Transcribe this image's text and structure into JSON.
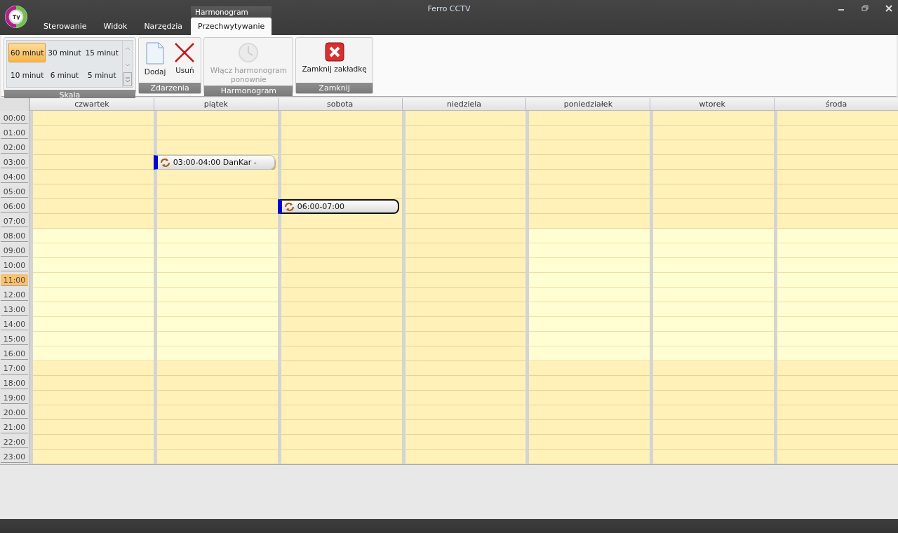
{
  "window": {
    "title": "Ferro CCTV"
  },
  "context_tab_group": "Harmonogram",
  "tabs": [
    {
      "label": "Sterowanie",
      "selected": false
    },
    {
      "label": "Widok",
      "selected": false
    },
    {
      "label": "Narzędzia",
      "selected": false
    },
    {
      "label": "Przechwytywanie",
      "selected": true
    }
  ],
  "ribbon": {
    "scale": {
      "label": "Skala",
      "options": [
        {
          "label": "60 minut",
          "selected": true
        },
        {
          "label": "30 minut",
          "selected": false
        },
        {
          "label": "15 minut",
          "selected": false
        },
        {
          "label": "10 minut",
          "selected": false
        },
        {
          "label": "6 minut",
          "selected": false
        },
        {
          "label": "5 minut",
          "selected": false
        }
      ]
    },
    "groups": [
      {
        "label": "Zdarzenia",
        "buttons": [
          {
            "kind": "add",
            "label": "Dodaj",
            "disabled": false
          },
          {
            "kind": "delete",
            "label": "Usuń",
            "disabled": false
          }
        ]
      },
      {
        "label": "Harmonogram",
        "buttons": [
          {
            "kind": "enable",
            "label": "Włącz harmonogram ponownie",
            "disabled": true
          }
        ]
      },
      {
        "label": "Zamknij",
        "buttons": [
          {
            "kind": "close",
            "label": "Zamknij zakładkę",
            "disabled": false
          }
        ]
      }
    ]
  },
  "calendar": {
    "days": [
      "czwartek",
      "piątek",
      "sobota",
      "niedziela",
      "poniedziałek",
      "wtorek",
      "środa"
    ],
    "hours": [
      {
        "label": "00:00",
        "current": false,
        "cells": [
          {
            "work": false
          },
          {
            "work": false
          },
          {
            "work": false
          },
          {
            "work": false
          },
          {
            "work": false
          },
          {
            "work": false
          },
          {
            "work": false
          }
        ]
      },
      {
        "label": "01:00",
        "current": false,
        "cells": [
          {
            "work": false
          },
          {
            "work": false
          },
          {
            "work": false
          },
          {
            "work": false
          },
          {
            "work": false
          },
          {
            "work": false
          },
          {
            "work": false
          }
        ]
      },
      {
        "label": "02:00",
        "current": false,
        "cells": [
          {
            "work": false
          },
          {
            "work": false
          },
          {
            "work": false
          },
          {
            "work": false
          },
          {
            "work": false
          },
          {
            "work": false
          },
          {
            "work": false
          }
        ]
      },
      {
        "label": "03:00",
        "current": false,
        "cells": [
          {
            "work": false
          },
          {
            "event": {
              "label": "03:00-04:00 DanKar -",
              "selected": false
            }
          },
          {
            "work": false
          },
          {
            "work": false
          },
          {
            "work": false
          },
          {
            "work": false
          },
          {
            "work": false
          }
        ]
      },
      {
        "label": "04:00",
        "current": false,
        "cells": [
          {
            "work": false
          },
          {
            "work": false
          },
          {
            "work": false
          },
          {
            "work": false
          },
          {
            "work": false
          },
          {
            "work": false
          },
          {
            "work": false
          }
        ]
      },
      {
        "label": "05:00",
        "current": false,
        "cells": [
          {
            "work": false
          },
          {
            "work": false
          },
          {
            "work": false
          },
          {
            "work": false
          },
          {
            "work": false
          },
          {
            "work": false
          },
          {
            "work": false
          }
        ]
      },
      {
        "label": "06:00",
        "current": false,
        "cells": [
          {
            "work": false
          },
          {
            "work": false
          },
          {
            "event": {
              "label": "06:00-07:00",
              "selected": true
            }
          },
          {
            "work": false
          },
          {
            "work": false
          },
          {
            "work": false
          },
          {
            "work": false
          }
        ]
      },
      {
        "label": "07:00",
        "current": false,
        "cells": [
          {
            "work": false
          },
          {
            "work": false
          },
          {
            "work": false
          },
          {
            "work": false
          },
          {
            "work": false
          },
          {
            "work": false
          },
          {
            "work": false
          }
        ]
      },
      {
        "label": "08:00",
        "current": false,
        "cells": [
          {
            "work": true
          },
          {
            "work": true
          },
          {
            "work": false
          },
          {
            "work": false
          },
          {
            "work": true
          },
          {
            "work": true
          },
          {
            "work": true
          }
        ]
      },
      {
        "label": "09:00",
        "current": false,
        "cells": [
          {
            "work": true
          },
          {
            "work": true
          },
          {
            "work": false
          },
          {
            "work": false
          },
          {
            "work": true
          },
          {
            "work": true
          },
          {
            "work": true
          }
        ]
      },
      {
        "label": "10:00",
        "current": false,
        "cells": [
          {
            "work": true
          },
          {
            "work": true
          },
          {
            "work": false
          },
          {
            "work": false
          },
          {
            "work": true
          },
          {
            "work": true
          },
          {
            "work": true
          }
        ]
      },
      {
        "label": "11:00",
        "current": true,
        "cells": [
          {
            "work": true
          },
          {
            "work": true
          },
          {
            "work": false
          },
          {
            "work": false
          },
          {
            "work": true
          },
          {
            "work": true
          },
          {
            "work": true
          }
        ]
      },
      {
        "label": "12:00",
        "current": false,
        "cells": [
          {
            "work": true
          },
          {
            "work": true
          },
          {
            "work": false
          },
          {
            "work": false
          },
          {
            "work": true
          },
          {
            "work": true
          },
          {
            "work": true
          }
        ]
      },
      {
        "label": "13:00",
        "current": false,
        "cells": [
          {
            "work": true
          },
          {
            "work": true
          },
          {
            "work": false
          },
          {
            "work": false
          },
          {
            "work": true
          },
          {
            "work": true
          },
          {
            "work": true
          }
        ]
      },
      {
        "label": "14:00",
        "current": false,
        "cells": [
          {
            "work": true
          },
          {
            "work": true
          },
          {
            "work": false
          },
          {
            "work": false
          },
          {
            "work": true
          },
          {
            "work": true
          },
          {
            "work": true
          }
        ]
      },
      {
        "label": "15:00",
        "current": false,
        "cells": [
          {
            "work": true
          },
          {
            "work": true
          },
          {
            "work": false
          },
          {
            "work": false
          },
          {
            "work": true
          },
          {
            "work": true
          },
          {
            "work": true
          }
        ]
      },
      {
        "label": "16:00",
        "current": false,
        "cells": [
          {
            "work": true
          },
          {
            "work": true
          },
          {
            "work": false
          },
          {
            "work": false
          },
          {
            "work": true
          },
          {
            "work": true
          },
          {
            "work": true
          }
        ]
      },
      {
        "label": "17:00",
        "current": false,
        "cells": [
          {
            "work": false
          },
          {
            "work": false
          },
          {
            "work": false
          },
          {
            "work": false
          },
          {
            "work": false
          },
          {
            "work": false
          },
          {
            "work": false
          }
        ]
      },
      {
        "label": "18:00",
        "current": false,
        "cells": [
          {
            "work": false
          },
          {
            "work": false
          },
          {
            "work": false
          },
          {
            "work": false
          },
          {
            "work": false
          },
          {
            "work": false
          },
          {
            "work": false
          }
        ]
      },
      {
        "label": "19:00",
        "current": false,
        "cells": [
          {
            "work": false
          },
          {
            "work": false
          },
          {
            "work": false
          },
          {
            "work": false
          },
          {
            "work": false
          },
          {
            "work": false
          },
          {
            "work": false
          }
        ]
      },
      {
        "label": "20:00",
        "current": false,
        "cells": [
          {
            "work": false
          },
          {
            "work": false
          },
          {
            "work": false
          },
          {
            "work": false
          },
          {
            "work": false
          },
          {
            "work": false
          },
          {
            "work": false
          }
        ]
      },
      {
        "label": "21:00",
        "current": false,
        "cells": [
          {
            "work": false
          },
          {
            "work": false
          },
          {
            "work": false
          },
          {
            "work": false
          },
          {
            "work": false
          },
          {
            "work": false
          },
          {
            "work": false
          }
        ]
      },
      {
        "label": "22:00",
        "current": false,
        "cells": [
          {
            "work": false
          },
          {
            "work": false
          },
          {
            "work": false
          },
          {
            "work": false
          },
          {
            "work": false
          },
          {
            "work": false
          },
          {
            "work": false
          }
        ]
      },
      {
        "label": "23:00",
        "current": false,
        "cells": [
          {
            "work": false
          },
          {
            "work": false
          },
          {
            "work": false
          },
          {
            "work": false
          },
          {
            "work": false
          },
          {
            "work": false
          },
          {
            "work": false
          }
        ]
      }
    ]
  }
}
